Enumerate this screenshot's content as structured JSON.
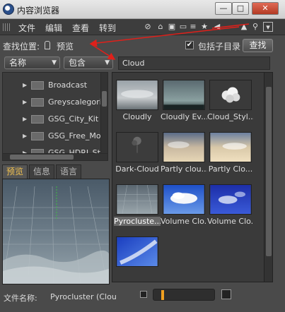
{
  "window": {
    "title": "内容浏览器",
    "minimize": "—",
    "maximize": "□",
    "close": "✕"
  },
  "menu": {
    "items": [
      "文件",
      "编辑",
      "查看",
      "转到"
    ]
  },
  "search_bar": {
    "location_label": "查找位置:",
    "location_value": "预览",
    "include_subdirs_label": "包括子目录",
    "include_subdirs_checked": "✔",
    "find_button": "查找"
  },
  "filter": {
    "field_select": "名称",
    "mode_select": "包含",
    "query": "Cloud"
  },
  "tree": {
    "items": [
      "Broadcast",
      "Greyscalegorill",
      "GSG_City_Kit",
      "GSG_Free_Mo",
      "GSG_HDRI_St"
    ]
  },
  "tabs": [
    "预览",
    "信息",
    "语言"
  ],
  "file_info": {
    "label": "文件名称:",
    "value": "Pyrocluster (Clou"
  },
  "thumbnails": [
    {
      "label": "Cloudly",
      "style": "sky-gray"
    },
    {
      "label": "Cloudly Ev...",
      "style": "sky-dark-teal"
    },
    {
      "label": "Cloud_Styl...",
      "style": "puffs-white"
    },
    {
      "label": "Dark-Cloud",
      "style": "dark-puff"
    },
    {
      "label": "Partly clou...",
      "style": "sky-warm"
    },
    {
      "label": "Partly Clo...",
      "style": "sky-warm-light"
    },
    {
      "label": "Pyrocluste...",
      "style": "pyro-gray"
    },
    {
      "label": "Volume Clo...",
      "style": "blue-white"
    },
    {
      "label": "Volume Clo...",
      "style": "blue-deep"
    },
    {
      "label": "",
      "style": "blue-streak"
    }
  ],
  "selected_thumbnail": "Pyrocluste...",
  "colors": {
    "annotation": "#e0201a",
    "accent_tab": "#f0c050",
    "slider_knob": "#f0a020"
  }
}
